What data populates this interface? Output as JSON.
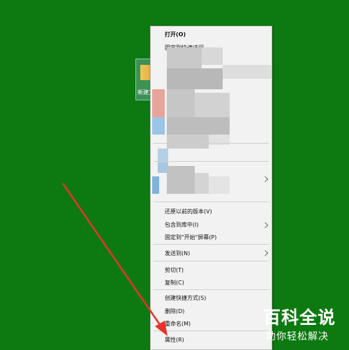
{
  "desktop": {
    "background_color": "#0d7a11",
    "icon": {
      "name": "folder-icon",
      "label": "新建文"
    }
  },
  "context_menu": {
    "open": "打开(O)",
    "pin_quick_access": "固定到快速访问",
    "restore_previous": "还原以前的版本(V)",
    "include_in_library": "包含到库中(I)",
    "pin_to_start": "固定到\"开始\"屏幕(P)",
    "send_to": "发送到(N)",
    "cut": "剪切(T)",
    "copy": "复制(C)",
    "create_shortcut": "创建快捷方式(S)",
    "delete": "删除(D)",
    "rename": "重命名(M)",
    "properties": "属性(R)"
  },
  "annotation": {
    "arrow_color": "#e8332a"
  },
  "watermark": {
    "title": "百科全说",
    "subtitle": "助你轻松解决"
  }
}
